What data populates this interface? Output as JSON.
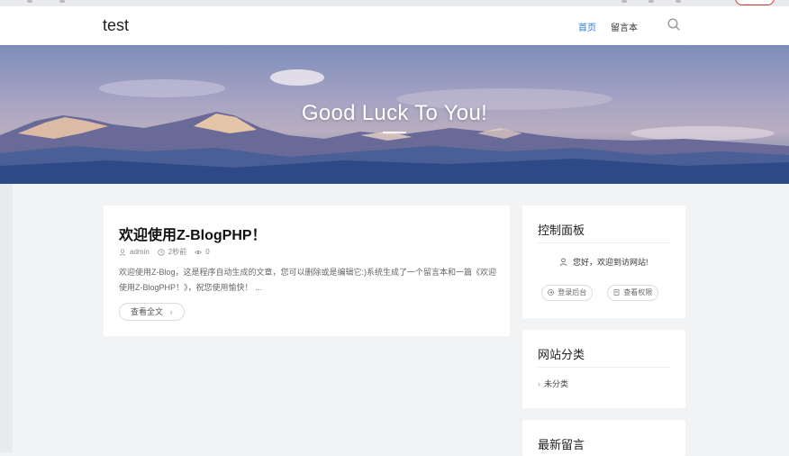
{
  "header": {
    "logo": "test",
    "nav": [
      {
        "label": "首页",
        "active": true
      },
      {
        "label": "留言本",
        "active": false
      }
    ]
  },
  "hero": {
    "title": "Good Luck To You!"
  },
  "post": {
    "title": "欢迎使用Z-BlogPHP！",
    "author": "admin",
    "time": "2秒前",
    "views": "0",
    "excerpt": "欢迎使用Z-Blog，这是程序自动生成的文章，您可以删除或是编辑它:)系统生成了一个留言本和一篇《欢迎使用Z-BlogPHP！》，祝您使用愉快！ ...",
    "read_more": "查看全文"
  },
  "sidebar": {
    "control_panel": {
      "title": "控制面板",
      "welcome": "您好，欢迎到访网站!",
      "login_button": "登录后台",
      "permissions_button": "查看权限"
    },
    "categories": {
      "title": "网站分类",
      "items": [
        "未分类"
      ]
    },
    "latest_comments": {
      "title": "最新留言"
    }
  },
  "colors": {
    "accent": "#2e7bd6",
    "page_bg": "#f2f3f5"
  }
}
